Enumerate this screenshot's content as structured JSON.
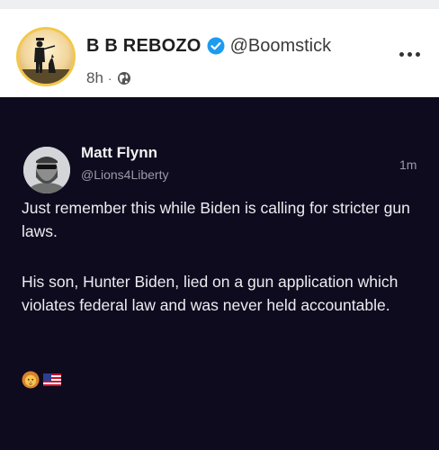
{
  "post": {
    "author_name": "B B REBOZO",
    "handle": "@Boomstick",
    "time": "8h",
    "separator": "·"
  },
  "embed": {
    "name": "Matt Flynn",
    "handle": "@Lions4Liberty",
    "time": "1m",
    "paragraph_1": "Just remember this while Biden is calling for stricter gun laws.",
    "paragraph_2": "His son, Hunter Biden, lied on a gun application which violates federal law and was never held accountable.",
    "emojis": [
      "lion-face",
      "us-flag"
    ]
  },
  "icons": {
    "verified": "verified-badge-icon",
    "audience": "globe-icon",
    "more": "more-options-icon"
  },
  "colors": {
    "verified": "#1d9bf0",
    "media_background": "#0f0b1f",
    "avatar_ring": "#f2c84b"
  }
}
